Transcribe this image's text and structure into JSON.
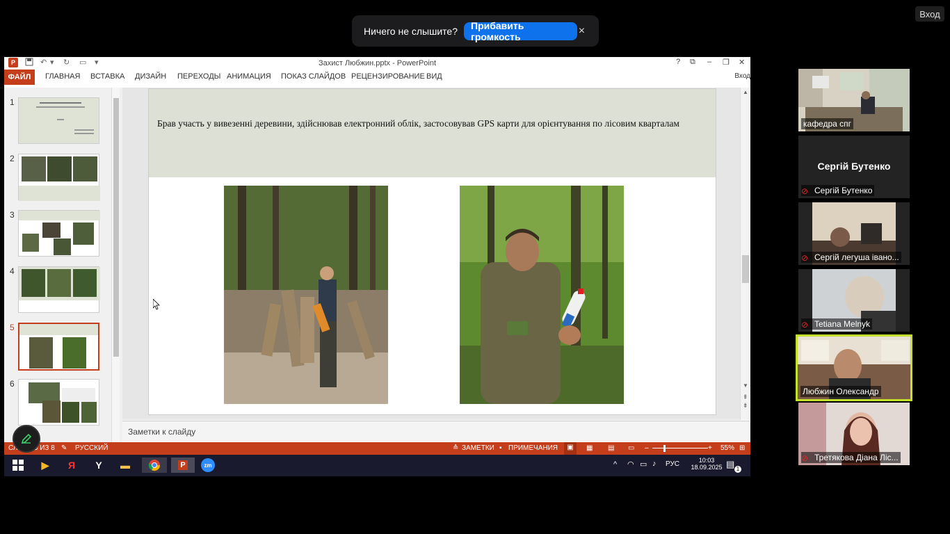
{
  "zoom_notice": {
    "text": "Ничего не слышите?",
    "button": "Прибавить громкость",
    "close": "×"
  },
  "top_right_button": "Вход",
  "ppt": {
    "window_title": "Захист Любжин.pptx - PowerPoint",
    "app_icon": "P",
    "quick_access": [
      "save-icon",
      "undo-icon",
      "redo-icon",
      "customize-icon"
    ],
    "window_controls": [
      "?",
      "⧉",
      "–",
      "❐",
      "✕"
    ],
    "tabs": {
      "file": "ФАЙЛ",
      "home": "ГЛАВНАЯ",
      "insert": "ВСТАВКА",
      "design": "ДИЗАЙН",
      "transitions": "ПЕРЕХОДЫ",
      "animation": "АНИМАЦИЯ",
      "slideshow": "ПОКАЗ СЛАЙДОВ",
      "review": "РЕЦЕНЗИРОВАНИЕ",
      "view": "ВИД"
    },
    "signin": "Вход",
    "thumbnails": [
      "1",
      "2",
      "3",
      "4",
      "5",
      "6"
    ],
    "slide_text": "Брав участь у вивезенні деревини, здійснював електронний облік, застосовував GPS карти  для орієнтування по лісовим кварталам",
    "notes_placeholder": "Заметки к слайду",
    "status": {
      "slide_count": "СЛАЙД 5 ИЗ 8",
      "language": "РУССКИЙ",
      "notes": "ЗАМЕТКИ",
      "comments": "ПРИМЕЧАНИЯ",
      "zoom": "55%"
    }
  },
  "taskbar": {
    "lang": "РУС",
    "time": "10:03",
    "date": "18.09.2025",
    "notifications": "1"
  },
  "participants": [
    {
      "name": "кафедра спг",
      "muted": false
    },
    {
      "name": "Сергій Бутенко",
      "muted": true,
      "big_name": "Сергій Бутенко"
    },
    {
      "name": "Сергій легуша івано...",
      "muted": true
    },
    {
      "name": "Tetiana Melnyk",
      "muted": true
    },
    {
      "name": "Любжин Олександр",
      "muted": false,
      "active_speaker": true
    },
    {
      "name": "Третякова Діана  Ліс...",
      "muted": true
    }
  ],
  "colors": {
    "ppt_accent": "#c43e1c",
    "zoom_blue": "#0e72ed",
    "speaker_border": "#c5e02a"
  }
}
